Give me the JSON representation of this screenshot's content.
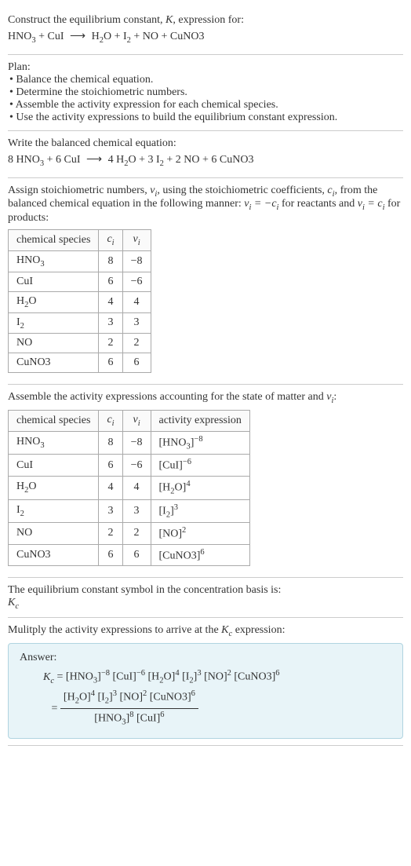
{
  "header": {
    "title_prefix": "Construct the equilibrium constant, ",
    "title_k": "K",
    "title_suffix": ", expression for:",
    "equation": "HNO₃ + CuI ⟶ H₂O + I₂ + NO + CuNO3"
  },
  "plan": {
    "title": "Plan:",
    "items": [
      "• Balance the chemical equation.",
      "• Determine the stoichiometric numbers.",
      "• Assemble the activity expression for each chemical species.",
      "• Use the activity expressions to build the equilibrium constant expression."
    ]
  },
  "balanced": {
    "intro": "Write the balanced chemical equation:",
    "equation": "8 HNO₃ + 6 CuI ⟶ 4 H₂O + 3 I₂ + 2 NO + 6 CuNO3"
  },
  "stoich": {
    "intro_1": "Assign stoichiometric numbers, ",
    "nu_i": "νᵢ",
    "intro_2": ", using the stoichiometric coefficients, ",
    "c_i": "cᵢ",
    "intro_3": ", from the balanced chemical equation in the following manner: ",
    "rel_1": "νᵢ = −cᵢ",
    "intro_4": " for reactants and ",
    "rel_2": "νᵢ = cᵢ",
    "intro_5": " for products:",
    "table": {
      "headers": [
        "chemical species",
        "cᵢ",
        "νᵢ"
      ],
      "rows": [
        {
          "species": "HNO₃",
          "c": "8",
          "nu": "−8"
        },
        {
          "species": "CuI",
          "c": "6",
          "nu": "−6"
        },
        {
          "species": "H₂O",
          "c": "4",
          "nu": "4"
        },
        {
          "species": "I₂",
          "c": "3",
          "nu": "3"
        },
        {
          "species": "NO",
          "c": "2",
          "nu": "2"
        },
        {
          "species": "CuNO3",
          "c": "6",
          "nu": "6"
        }
      ]
    }
  },
  "activity": {
    "intro_1": "Assemble the activity expressions accounting for the state of matter and ",
    "nu_i": "νᵢ",
    "intro_2": ":",
    "table": {
      "headers": [
        "chemical species",
        "cᵢ",
        "νᵢ",
        "activity expression"
      ],
      "rows": [
        {
          "species": "HNO₃",
          "c": "8",
          "nu": "−8",
          "expr_base": "[HNO₃]",
          "expr_exp": "−8"
        },
        {
          "species": "CuI",
          "c": "6",
          "nu": "−6",
          "expr_base": "[CuI]",
          "expr_exp": "−6"
        },
        {
          "species": "H₂O",
          "c": "4",
          "nu": "4",
          "expr_base": "[H₂O]",
          "expr_exp": "4"
        },
        {
          "species": "I₂",
          "c": "3",
          "nu": "3",
          "expr_base": "[I₂]",
          "expr_exp": "3"
        },
        {
          "species": "NO",
          "c": "2",
          "nu": "2",
          "expr_base": "[NO]",
          "expr_exp": "2"
        },
        {
          "species": "CuNO3",
          "c": "6",
          "nu": "6",
          "expr_base": "[CuNO3]",
          "expr_exp": "6"
        }
      ]
    }
  },
  "symbol": {
    "text": "The equilibrium constant symbol in the concentration basis is:",
    "kc": "K",
    "kc_sub": "c"
  },
  "multiply": {
    "text_1": "Mulitply the activity expressions to arrive at the ",
    "kc": "K",
    "kc_sub": "c",
    "text_2": " expression:"
  },
  "answer": {
    "label": "Answer:",
    "kc": "K",
    "kc_sub": "c",
    "eq": " = ",
    "line1": "[HNO₃]⁻⁸ [CuI]⁻⁶ [H₂O]⁴ [I₂]³ [NO]² [CuNO3]⁶",
    "numerator": "[H₂O]⁴ [I₂]³ [NO]² [CuNO3]⁶",
    "denominator": "[HNO₃]⁸ [CuI]⁶"
  }
}
